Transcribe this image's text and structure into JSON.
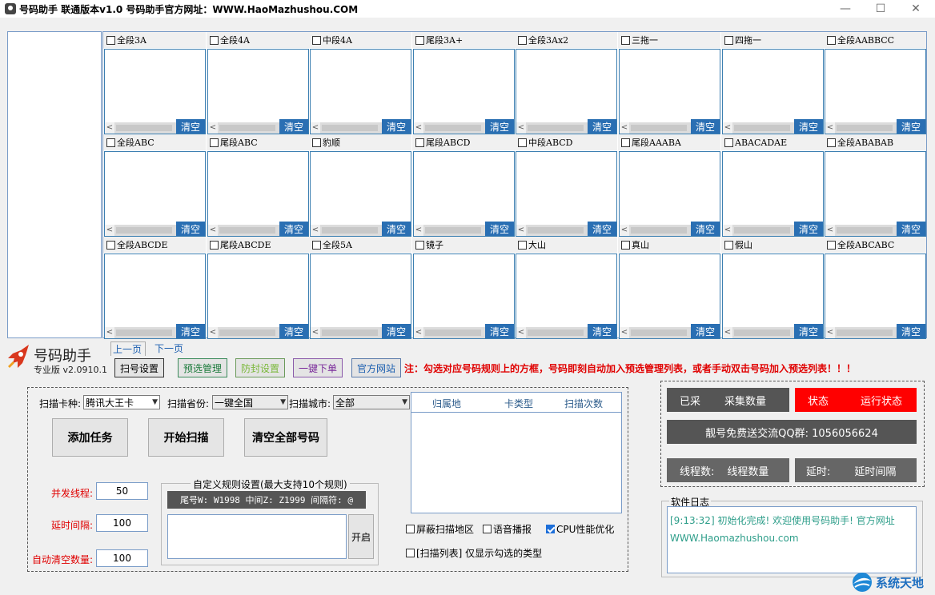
{
  "window": {
    "title": "号码助手 联通版本v1.0 号码助手官方网址：WWW.HaoMazhushou.COM",
    "minimize": "—",
    "maximize": "☐",
    "close": "✕"
  },
  "categories": [
    {
      "label": "全段3A"
    },
    {
      "label": "全段4A"
    },
    {
      "label": "中段4A"
    },
    {
      "label": "尾段3A+"
    },
    {
      "label": "全段3Ax2"
    },
    {
      "label": "三拖一"
    },
    {
      "label": "四拖一"
    },
    {
      "label": "全段AABBCC"
    },
    {
      "label": "全段ABC"
    },
    {
      "label": "尾段ABC"
    },
    {
      "label": "豹顺"
    },
    {
      "label": "尾段ABCD"
    },
    {
      "label": "中段ABCD"
    },
    {
      "label": "尾段AAABA"
    },
    {
      "label": "ABACADAE"
    },
    {
      "label": "全段ABABAB"
    },
    {
      "label": "全段ABCDE"
    },
    {
      "label": "尾段ABCDE"
    },
    {
      "label": "全段5A"
    },
    {
      "label": "镜子"
    },
    {
      "label": "大山"
    },
    {
      "label": "真山"
    },
    {
      "label": "假山"
    },
    {
      "label": "全段ABCABC"
    }
  ],
  "clear_label": "清空",
  "pager": {
    "prev": "上一页",
    "next": "下一页"
  },
  "brand": {
    "name": "号码助手",
    "edition": "专业版 v2.0910.1"
  },
  "toolbar": {
    "scan_settings": "扫号设置",
    "preselect": "预选管理",
    "block": "防封设置",
    "one_click_order": "一键下单",
    "website": "官方网站",
    "note": "注：勾选对应号码规则上的方框，号码即刻自动加入预选管理列表，或者手动双击号码加入预选列表！！！"
  },
  "scan": {
    "card_label": "扫描卡种:",
    "card_value": "腾讯大王卡",
    "province_label": "扫描省份:",
    "province_value": "一键全国",
    "city_label": "扫描城市:",
    "city_value": "全部",
    "add_task": "添加任务",
    "start_scan": "开始扫描",
    "clear_all": "清空全部号码",
    "threads_label": "并发线程:",
    "threads_value": "50",
    "delay_label": "延时间隔:",
    "delay_value": "100",
    "auto_clear_label": "自动清空数量:",
    "auto_clear_value": "100",
    "rules_title": "自定义规则设置(最大支持10个规则)",
    "rules_hint": "尾号W: W1998 中间Z: Z1999 间隔符: @",
    "open": "开启"
  },
  "table": {
    "headers": [
      "归属地",
      "卡类型",
      "扫描次数"
    ]
  },
  "options": {
    "block_region": "屏蔽扫描地区",
    "voice": "语音播报",
    "cpu_opt": "CPU性能优化",
    "scan_list": "[扫描列表] 仅显示勾选的类型"
  },
  "status": {
    "collected_label": "已采",
    "collected_value": "采集数量",
    "state_label": "状态",
    "state_value": "运行状态",
    "qq_group": "靓号免费送交流QQ群: 1056056624",
    "threads_label": "线程数:",
    "threads_value": "线程数量",
    "delay_label": "延时:",
    "delay_value": "延时间隔"
  },
  "log": {
    "title": "软件日志",
    "line1": "[9:13:32] 初始化完成! 欢迎使用号码助手! 官方网址",
    "line2": "WWW.Haomazhushou.com"
  },
  "watermark": "系统天地",
  "colors": {
    "accent_blue": "#2a6fb3",
    "status_red": "#ff0000",
    "note_red": "#e00000",
    "dark_panel": "#555555"
  }
}
